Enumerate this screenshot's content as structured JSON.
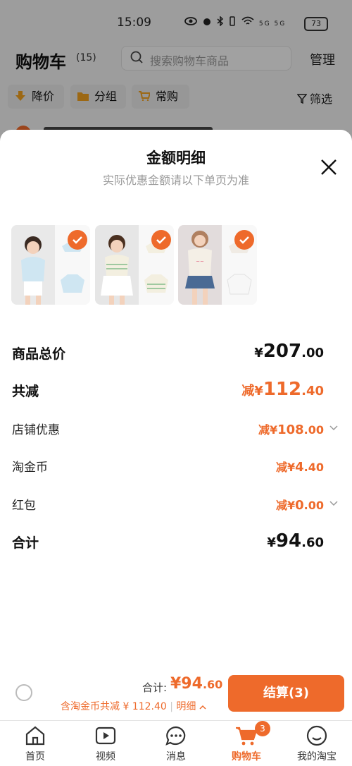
{
  "status_bar": {
    "time": "15:09",
    "signal_text": "5G 5G",
    "battery": "73"
  },
  "header": {
    "title": "购物车",
    "count": "(15)",
    "search_placeholder": "搜索购物车商品",
    "manage": "管理"
  },
  "chips": [
    {
      "label": "降价",
      "icon": "arrow-down-icon"
    },
    {
      "label": "分组",
      "icon": "folder-icon"
    },
    {
      "label": "常购",
      "icon": "cart-icon"
    }
  ],
  "filter": {
    "label": "筛选",
    "icon": "filter-icon"
  },
  "sheet": {
    "title": "金额明细",
    "subtitle": "实际优惠金额请以下单页为准",
    "products": [
      {
        "name": "product-1",
        "selected": true,
        "shirt_color": "#cfe6f2"
      },
      {
        "name": "product-2",
        "selected": true,
        "shirt_color": "#f3efe0"
      },
      {
        "name": "product-3",
        "selected": true,
        "shirt_color": "#f4efe6"
      }
    ],
    "rows": [
      {
        "label": "商品总价",
        "prefix": "¥",
        "int": "207",
        "dec": ".00",
        "bold": true,
        "highlight": false,
        "expandable": false
      },
      {
        "label": "共减",
        "prefix": "减¥",
        "int": "112",
        "dec": ".40",
        "bold": true,
        "highlight": true,
        "expandable": false
      },
      {
        "label": "店铺优惠",
        "prefix": "减¥",
        "int": "108",
        "dec": ".00",
        "bold": false,
        "highlight": true,
        "expandable": true
      },
      {
        "label": "淘金币",
        "prefix": "减¥",
        "int": "4",
        "dec": ".40",
        "bold": false,
        "highlight": true,
        "expandable": false
      },
      {
        "label": "红包",
        "prefix": "减¥",
        "int": "0",
        "dec": ".00",
        "bold": false,
        "highlight": true,
        "expandable": true
      },
      {
        "label": "合计",
        "prefix": "¥",
        "int": "94",
        "dec": ".60",
        "bold": true,
        "highlight": false,
        "expandable": false
      }
    ]
  },
  "checkout_bar": {
    "total_label": "合计:",
    "total_int": "¥94",
    "total_dec": ".60",
    "coin_note": "含淘金币共减 ¥ 112.40",
    "detail": "明细",
    "checkout_label": "结算(3)"
  },
  "tabs": [
    {
      "label": "首页",
      "icon": "home-icon",
      "active": false
    },
    {
      "label": "视频",
      "icon": "video-icon",
      "active": false
    },
    {
      "label": "消息",
      "icon": "message-icon",
      "active": false
    },
    {
      "label": "购物车",
      "icon": "cart-icon",
      "active": true
    },
    {
      "label": "我的淘宝",
      "icon": "profile-icon",
      "active": false
    }
  ],
  "cart_badge": "3",
  "colors": {
    "accent": "#ee6a2b",
    "chip_arrow": "#f0a020"
  }
}
